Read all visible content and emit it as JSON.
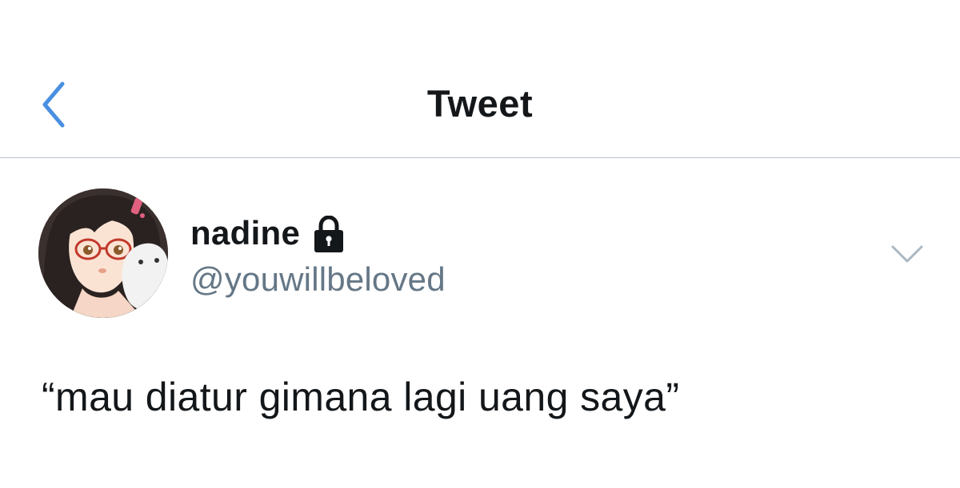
{
  "header": {
    "title": "Tweet",
    "back_icon": "chevron-left-icon",
    "accent_color": "#4a90e2"
  },
  "tweet": {
    "author": {
      "display_name": "nadine",
      "handle": "@youwillbeloved",
      "protected_icon": "lock-icon",
      "avatar": "anime-girl-glasses-avatar"
    },
    "menu_icon": "chevron-down-icon",
    "text": "“mau diatur gimana lagi uang saya”"
  }
}
